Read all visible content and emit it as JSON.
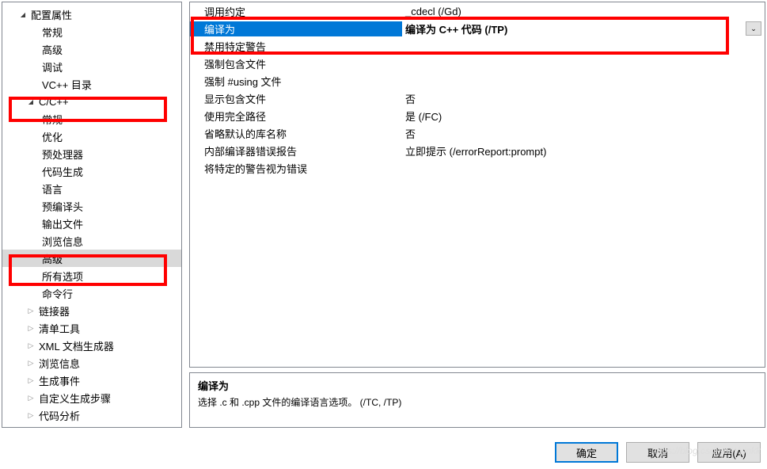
{
  "tree": {
    "root": "配置属性",
    "items": [
      "常规",
      "高级",
      "调试",
      "VC++ 目录"
    ],
    "cpp_node": "C/C++",
    "cpp_items": [
      "常规",
      "优化",
      "预处理器",
      "代码生成",
      "语言",
      "预编译头",
      "输出文件",
      "浏览信息",
      "高级",
      "所有选项",
      "命令行"
    ],
    "bottom_nodes": [
      "链接器",
      "清单工具",
      "XML 文档生成器",
      "浏览信息",
      "生成事件",
      "自定义生成步骤",
      "代码分析"
    ]
  },
  "props": [
    {
      "label": "调用约定",
      "value": "_cdecl (/Gd)"
    },
    {
      "label": "编译为",
      "value": "编译为 C++ 代码 (/TP)"
    },
    {
      "label": "禁用特定警告",
      "value": ""
    },
    {
      "label": "强制包含文件",
      "value": ""
    },
    {
      "label": "强制 #using 文件",
      "value": ""
    },
    {
      "label": "显示包含文件",
      "value": "否"
    },
    {
      "label": "使用完全路径",
      "value": "是 (/FC)"
    },
    {
      "label": "省略默认的库名称",
      "value": "否"
    },
    {
      "label": "内部编译器错误报告",
      "value": "立即提示 (/errorReport:prompt)"
    },
    {
      "label": "将特定的警告视为错误",
      "value": ""
    }
  ],
  "desc": {
    "title": "编译为",
    "text": "选择 .c 和 .cpp 文件的编译语言选项。     (/TC, /TP)"
  },
  "buttons": {
    "ok": "确定",
    "cancel": "取消",
    "apply": "应用(A)"
  }
}
